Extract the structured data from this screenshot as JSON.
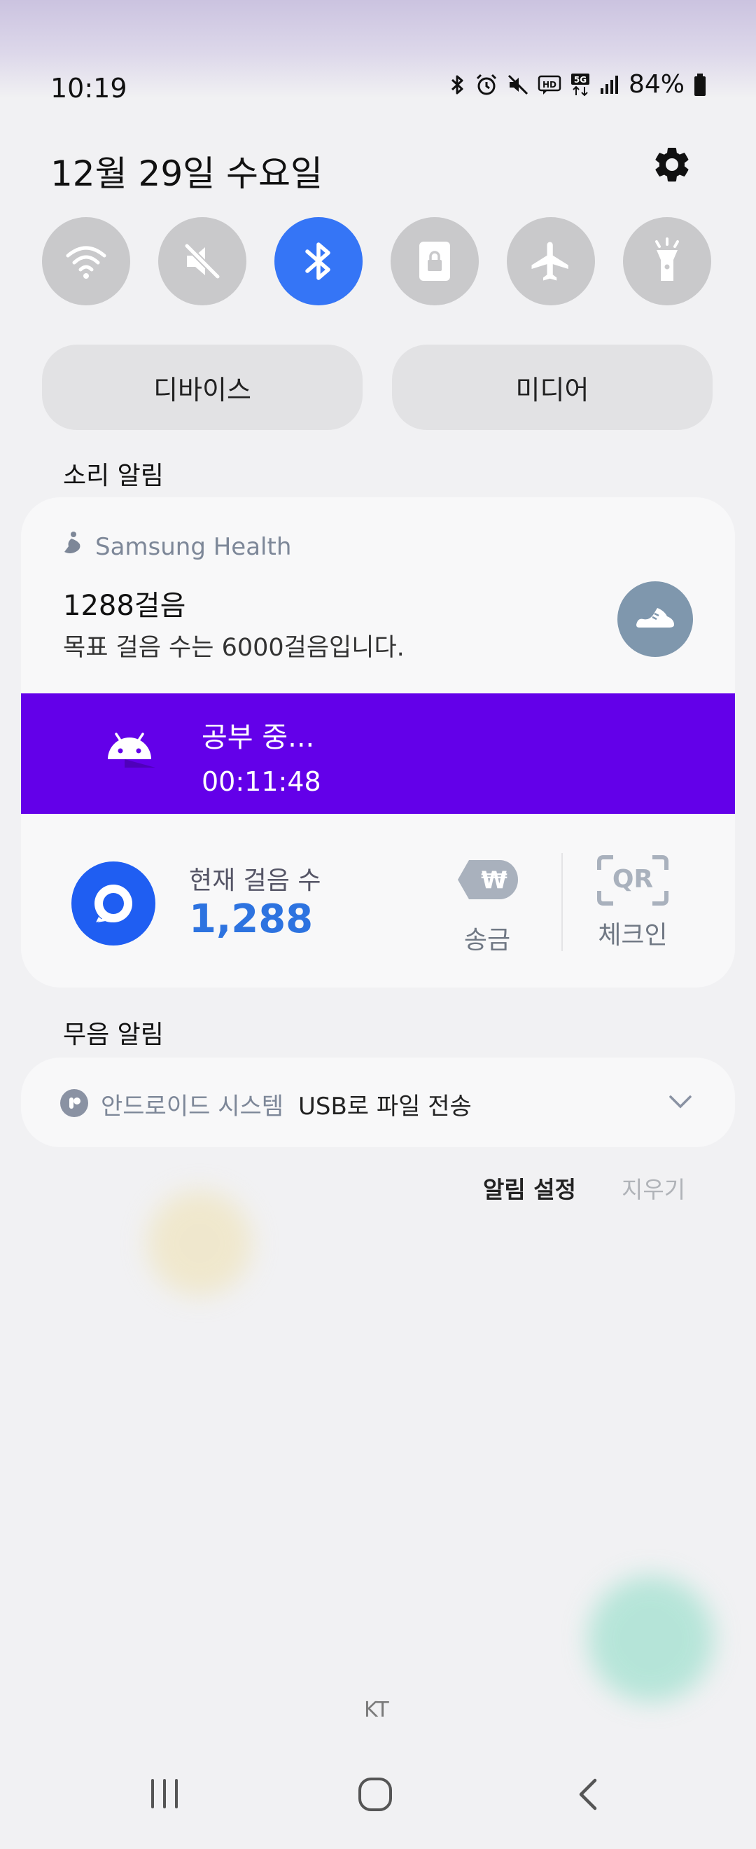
{
  "status_bar": {
    "time": "10:19",
    "battery": "84%"
  },
  "header": {
    "date": "12월 29일 수요일"
  },
  "quick_toggles": [
    {
      "name": "wifi",
      "on": false
    },
    {
      "name": "mute",
      "on": false
    },
    {
      "name": "bluetooth",
      "on": true
    },
    {
      "name": "secure-folder",
      "on": false
    },
    {
      "name": "airplane",
      "on": false
    },
    {
      "name": "flashlight",
      "on": false
    }
  ],
  "pills": {
    "devices": "디바이스",
    "media": "미디어"
  },
  "sections": {
    "sound": "소리 알림",
    "silent": "무음 알림"
  },
  "samsung_health": {
    "app": "Samsung Health",
    "steps": "1288걸음",
    "goal": "목표 걸음 수는 6000걸음입니다."
  },
  "timer": {
    "title": "공부 중...",
    "elapsed": "00:11:48"
  },
  "widget": {
    "label": "현재 걸음 수",
    "value": "1,288",
    "send": "송금",
    "checkin": "체크인",
    "qr": "QR"
  },
  "system_notification": {
    "app": "안드로이드 시스템",
    "title": "USB로 파일 전송"
  },
  "actions": {
    "settings": "알림 설정",
    "clear": "지우기"
  },
  "carrier": "KT",
  "colors": {
    "accent": "#3575f6",
    "timer_band": "#6300e9",
    "widget_value": "#2d73e0"
  }
}
